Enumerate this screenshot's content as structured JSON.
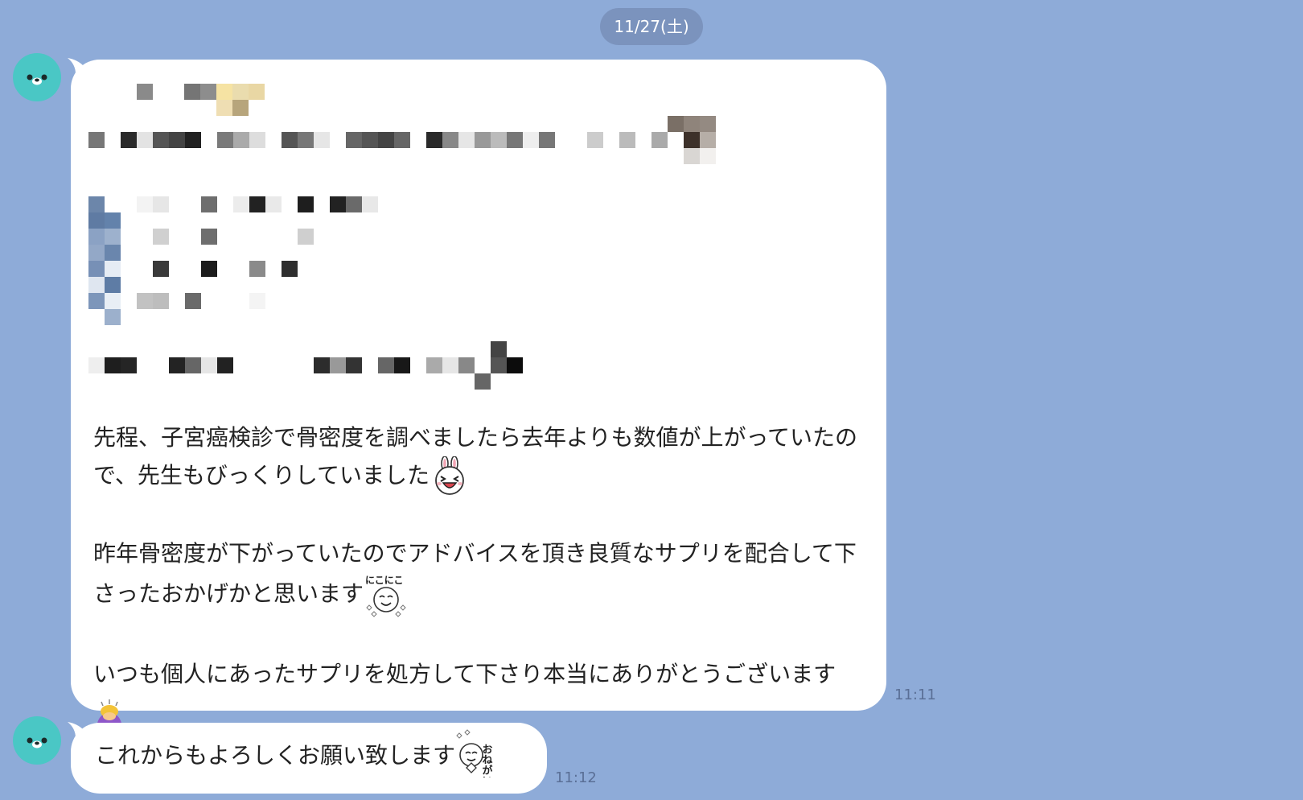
{
  "chat": {
    "date_label": "11/27(土)",
    "messages": [
      {
        "paragraphs": [
          "先程、子宮癌検診で骨密度を調べましたら去年よりも数値が上がっていたので、先生もびっくりしていました",
          "昨年骨密度が下がっていたのでアドバイスを頂き良質なサプリを配合して下さったおかげかと思います",
          "いつも個人にあったサプリを処方して下さり本当にありがとうございます"
        ],
        "time": "11:11",
        "redacted_top_section": true
      },
      {
        "text": "これからもよろしくお願い致します",
        "time": "11:12"
      }
    ],
    "stickers": {
      "bunny": "line-bunny-laughing",
      "nikoniko": "にこにこ",
      "bowing": "person-bowing-emoji",
      "onegai": "おねがい"
    }
  },
  "colors": {
    "background": "#8eabd8",
    "bubble": "#ffffff",
    "avatar": "#4ac7c5",
    "date_pill": "#7b93bd"
  }
}
